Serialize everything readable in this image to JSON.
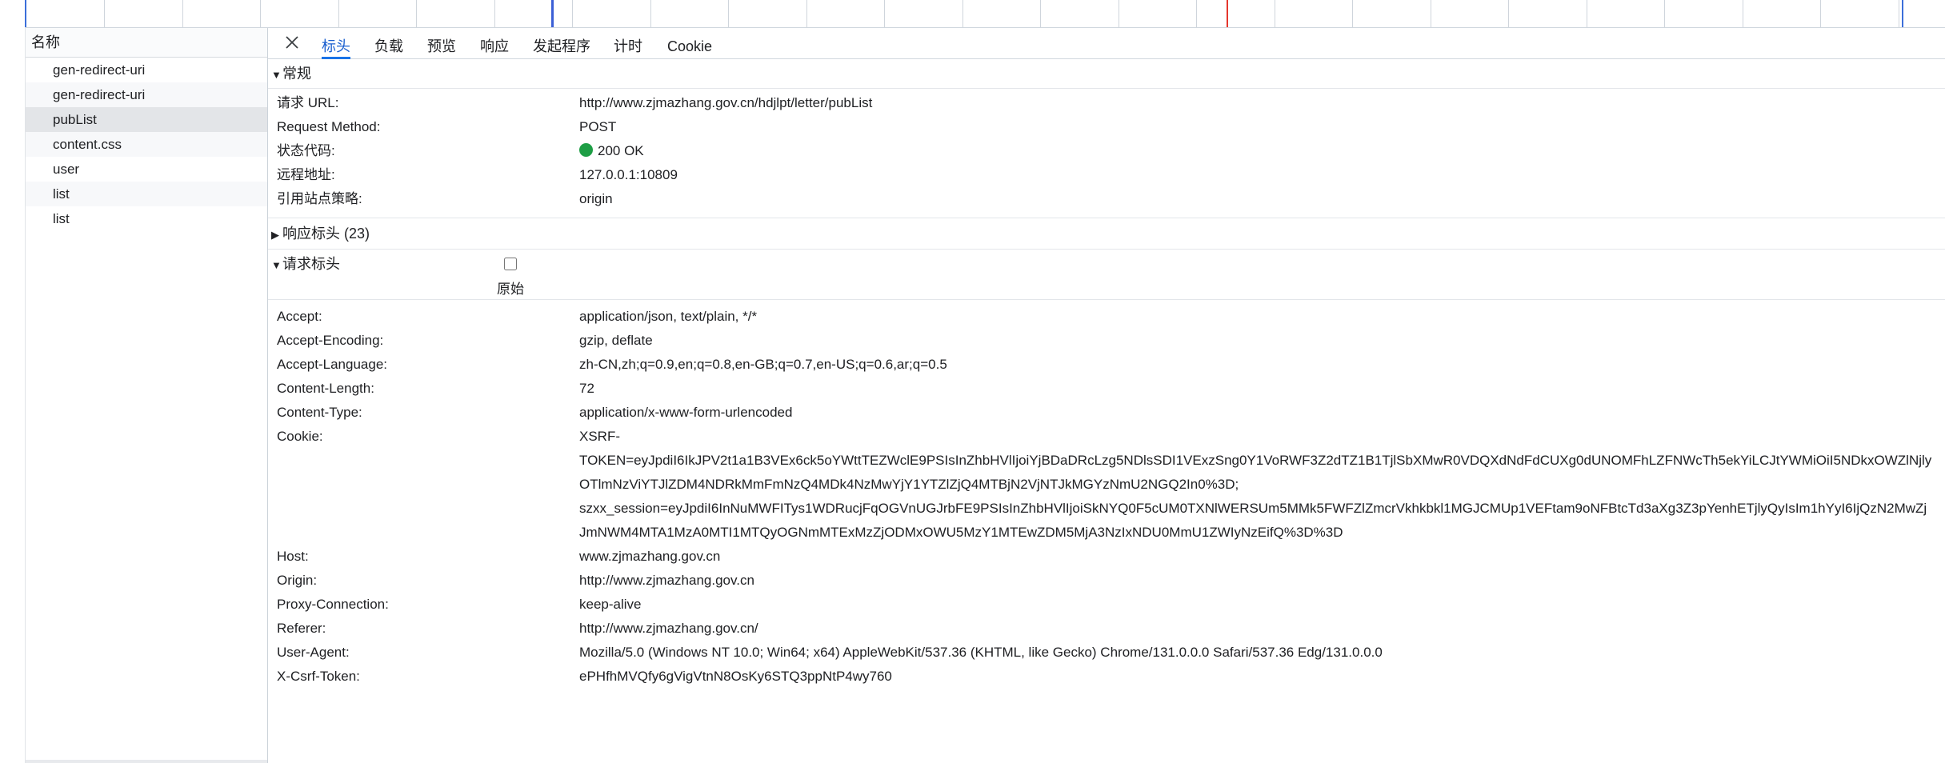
{
  "request_list": {
    "header": "名称",
    "items": [
      {
        "name": "gen-redirect-uri"
      },
      {
        "name": "gen-redirect-uri"
      },
      {
        "name": "pubList"
      },
      {
        "name": "content.css"
      },
      {
        "name": "user"
      },
      {
        "name": "list"
      },
      {
        "name": "list"
      }
    ],
    "selected_index": 2
  },
  "tabs": [
    "标头",
    "负载",
    "预览",
    "响应",
    "发起程序",
    "计时",
    "Cookie"
  ],
  "active_tab": "标头",
  "general": {
    "title": "常规",
    "rows": [
      {
        "key": "请求 URL:",
        "value": "http://www.zjmazhang.gov.cn/hdjlpt/letter/pubList"
      },
      {
        "key": "Request Method:",
        "value": "POST"
      },
      {
        "key": "状态代码:",
        "value": "200 OK",
        "status_color": "#1e9e45"
      },
      {
        "key": "远程地址:",
        "value": "127.0.0.1:10809"
      },
      {
        "key": "引用站点策略:",
        "value": "origin"
      }
    ]
  },
  "response_headers": {
    "title": "响应标头 (23)"
  },
  "request_headers": {
    "title": "请求标头",
    "raw_label": "原始",
    "raw_checked": false,
    "rows": [
      {
        "key": "Accept:",
        "value": "application/json, text/plain, */*"
      },
      {
        "key": "Accept-Encoding:",
        "value": "gzip, deflate"
      },
      {
        "key": "Accept-Language:",
        "value": "zh-CN,zh;q=0.9,en;q=0.8,en-GB;q=0.7,en-US;q=0.6,ar;q=0.5"
      },
      {
        "key": "Content-Length:",
        "value": "72"
      },
      {
        "key": "Content-Type:",
        "value": "application/x-www-form-urlencoded"
      },
      {
        "key": "Cookie:",
        "lines": [
          "XSRF-",
          "TOKEN=eyJpdiI6IkJPV2t1a1B3VEx6ck5oYWttTEZWclE9PSIsInZhbHVlIjoiYjBDaDRcLzg5NDlsSDI1VExzSng0Y1VoRWF3Z2dTZ1B1TjlSbXMwR0VDQXdNdFdCUXg0dUNOMFhLZFNWcTh5ekYiLCJtYWMiOiI5NDkxOWZlNjly",
          "OTlmNzViYTJlZDM4NDRkMmFmNzQ4MDk4NzMwYjY1YTZlZjQ4MTBjN2VjNTJkMGYzNmU2NGQ2In0%3D;",
          "szxx_session=eyJpdiI6InNuMWFITys1WDRucjFqOGVnUGJrbFE9PSIsInZhbHVlIjoiSkNYQ0F5cUM0TXNlWERSUm5MMk5FWFZlZmcrVkhkbkl1MGJCMUp1VEFtam9oNFBtcTd3aXg3Z3pYenhETjlyQyIsIm1hYyI6IjQzN2MwZj",
          "JmNWM4MTA1MzA0MTI1MTQyOGNmMTExMzZjODMxOWU5MzY1MTEwZDM5MjA3NzIxNDU0MmU1ZWIyNzEifQ%3D%3D"
        ]
      },
      {
        "key": "Host:",
        "value": "www.zjmazhang.gov.cn"
      },
      {
        "key": "Origin:",
        "value": "http://www.zjmazhang.gov.cn"
      },
      {
        "key": "Proxy-Connection:",
        "value": "keep-alive"
      },
      {
        "key": "Referer:",
        "value": "http://www.zjmazhang.gov.cn/"
      },
      {
        "key": "User-Agent:",
        "value": "Mozilla/5.0 (Windows NT 10.0; Win64; x64) AppleWebKit/537.36 (KHTML, like Gecko) Chrome/131.0.0.0 Safari/537.36 Edg/131.0.0.0"
      },
      {
        "key": "X-Csrf-Token:",
        "value": "ePHfhMVQfy6gVigVtnN8OsKy6STQ3ppNtP4wy760"
      }
    ]
  },
  "colors": {
    "accent": "#1a73e8",
    "status_ok": "#1e9e45",
    "timeline_blue": "#3b5fd6",
    "timeline_red": "#e5362d"
  }
}
